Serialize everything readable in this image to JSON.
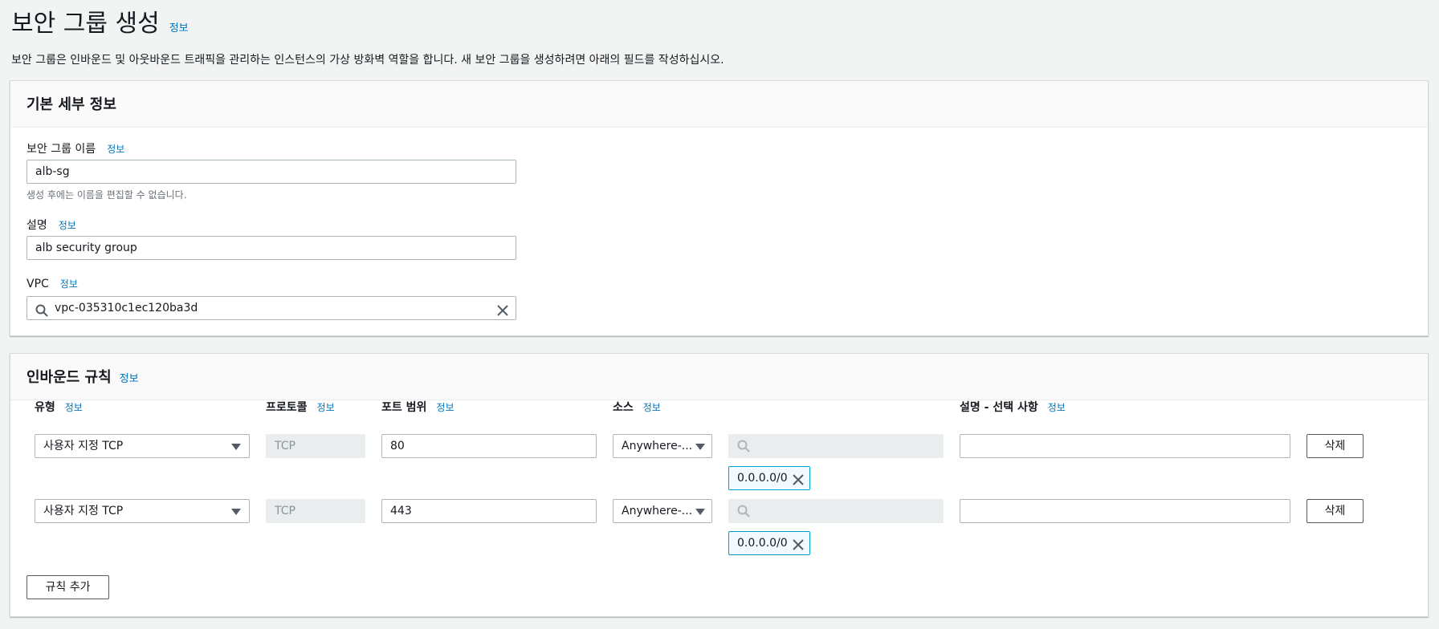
{
  "page": {
    "title": "보안 그룹 생성",
    "title_info": "정보",
    "description": "보안 그룹은 인바운드 및 아웃바운드 트래픽을 관리하는 인스턴스의 가상 방화벽 역할을 합니다. 새 보안 그룹을 생성하려면 아래의 필드를 작성하십시오."
  },
  "basic": {
    "title": "기본 세부 정보",
    "name_label": "보안 그룹 이름",
    "name_info": "정보",
    "name_value": "alb-sg",
    "name_hint": "생성 후에는 이름을 편집할 수 없습니다.",
    "desc_label": "설명",
    "desc_info": "정보",
    "desc_value": "alb security group",
    "vpc_label": "VPC",
    "vpc_info": "정보",
    "vpc_value": "vpc-035310c1ec120ba3d"
  },
  "inbound": {
    "title": "인바운드 규칙",
    "title_info": "정보",
    "headers": {
      "type": "유형",
      "protocol": "프로토콜",
      "port": "포트 범위",
      "source": "소스",
      "description": "설명 - 선택 사항",
      "info": "정보"
    },
    "rules": [
      {
        "type": "사용자 지정 TCP",
        "protocol": "TCP",
        "port": "80",
        "source": "Anywhere-...",
        "cidr": "0.0.0.0/0",
        "description": "",
        "delete": "삭제"
      },
      {
        "type": "사용자 지정 TCP",
        "protocol": "TCP",
        "port": "443",
        "source": "Anywhere-...",
        "cidr": "0.0.0.0/0",
        "description": "",
        "delete": "삭제"
      }
    ],
    "add_rule": "규칙 추가"
  },
  "icons": {
    "search": "search-icon",
    "clear": "close-icon",
    "dropdown": "caret-down-icon"
  },
  "colors": {
    "link": "#0073bb",
    "token_border": "#00a1c9",
    "token_bg": "#f1faff",
    "background": "#f2f3f3"
  }
}
